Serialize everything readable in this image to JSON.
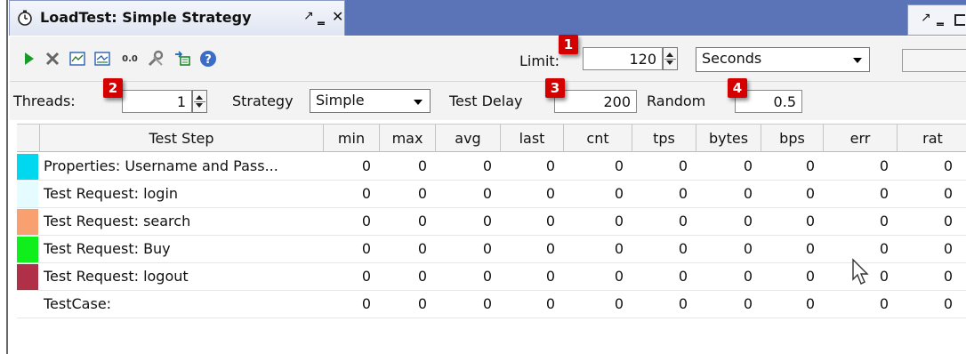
{
  "window": {
    "title": "LoadTest: Simple Strategy",
    "pin_glyph": "↗",
    "min_glyph": "‗",
    "close_glyph": "✕",
    "right_pin_glyph": "↗",
    "right_min_glyph": "‗"
  },
  "toolbar": {
    "icons": [
      "run-icon",
      "cancel-icon",
      "chart-icon",
      "statistics-icon",
      "number-icon",
      "tools-icon",
      "export-icon",
      "help-icon"
    ],
    "number_label": "0.0",
    "limit_label": "Limit:",
    "limit_value": "120",
    "limit_unit": "Seconds"
  },
  "settings": {
    "threads_label": "Threads:",
    "threads_value": "1",
    "strategy_label": "Strategy",
    "strategy_value": "Simple",
    "test_delay_label": "Test Delay",
    "test_delay_value": "200",
    "random_label": "Random",
    "random_value": "0.5"
  },
  "badges": [
    "1",
    "2",
    "3",
    "4"
  ],
  "table": {
    "columns": [
      "Test Step",
      "min",
      "max",
      "avg",
      "last",
      "cnt",
      "tps",
      "bytes",
      "bps",
      "err",
      "rat"
    ],
    "rows": [
      {
        "name": "Properties: Username and Pass...",
        "color": "#00d8f0",
        "values": [
          "0",
          "0",
          "0",
          "0",
          "0",
          "0",
          "0",
          "0",
          "0",
          "0"
        ]
      },
      {
        "name": "Test Request: login",
        "color": "#e4fbff",
        "values": [
          "0",
          "0",
          "0",
          "0",
          "0",
          "0",
          "0",
          "0",
          "0",
          "0"
        ]
      },
      {
        "name": "Test Request: search",
        "color": "#f8a070",
        "values": [
          "0",
          "0",
          "0",
          "0",
          "0",
          "0",
          "0",
          "0",
          "0",
          "0"
        ]
      },
      {
        "name": "Test Request: Buy",
        "color": "#10ee1c",
        "values": [
          "0",
          "0",
          "0",
          "0",
          "0",
          "0",
          "0",
          "0",
          "0",
          "0"
        ]
      },
      {
        "name": "Test Request: logout",
        "color": "#b03048",
        "values": [
          "0",
          "0",
          "0",
          "0",
          "0",
          "0",
          "0",
          "0",
          "0",
          "0"
        ]
      },
      {
        "name": "TestCase:",
        "color": "#ffffff",
        "values": [
          "0",
          "0",
          "0",
          "0",
          "0",
          "0",
          "0",
          "0",
          "0",
          "0"
        ]
      }
    ]
  }
}
